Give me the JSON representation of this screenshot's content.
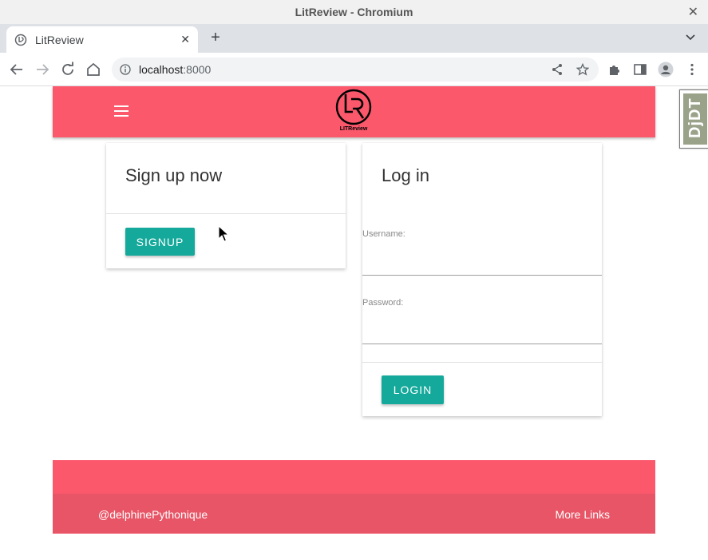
{
  "window": {
    "title": "LitReview - Chromium"
  },
  "tab": {
    "title": "LitReview"
  },
  "toolbar": {
    "url_host": "localhost",
    "url_port": ":8000"
  },
  "navbar": {
    "logo_text": "LITReview"
  },
  "signup_card": {
    "title": "Sign up now",
    "button_label": "SIGNUP"
  },
  "login_card": {
    "title": "Log in",
    "username_label": "Username:",
    "username_value": "",
    "password_label": "Password:",
    "password_value": "",
    "button_label": "LOGIN"
  },
  "footer": {
    "left_text": "@delphinePythonique",
    "right_link": "More Links"
  },
  "djdt": {
    "label": "DjDT"
  },
  "colors": {
    "primary": "#fb586c",
    "footer_dark": "#e85566",
    "accent": "#14a99b"
  }
}
